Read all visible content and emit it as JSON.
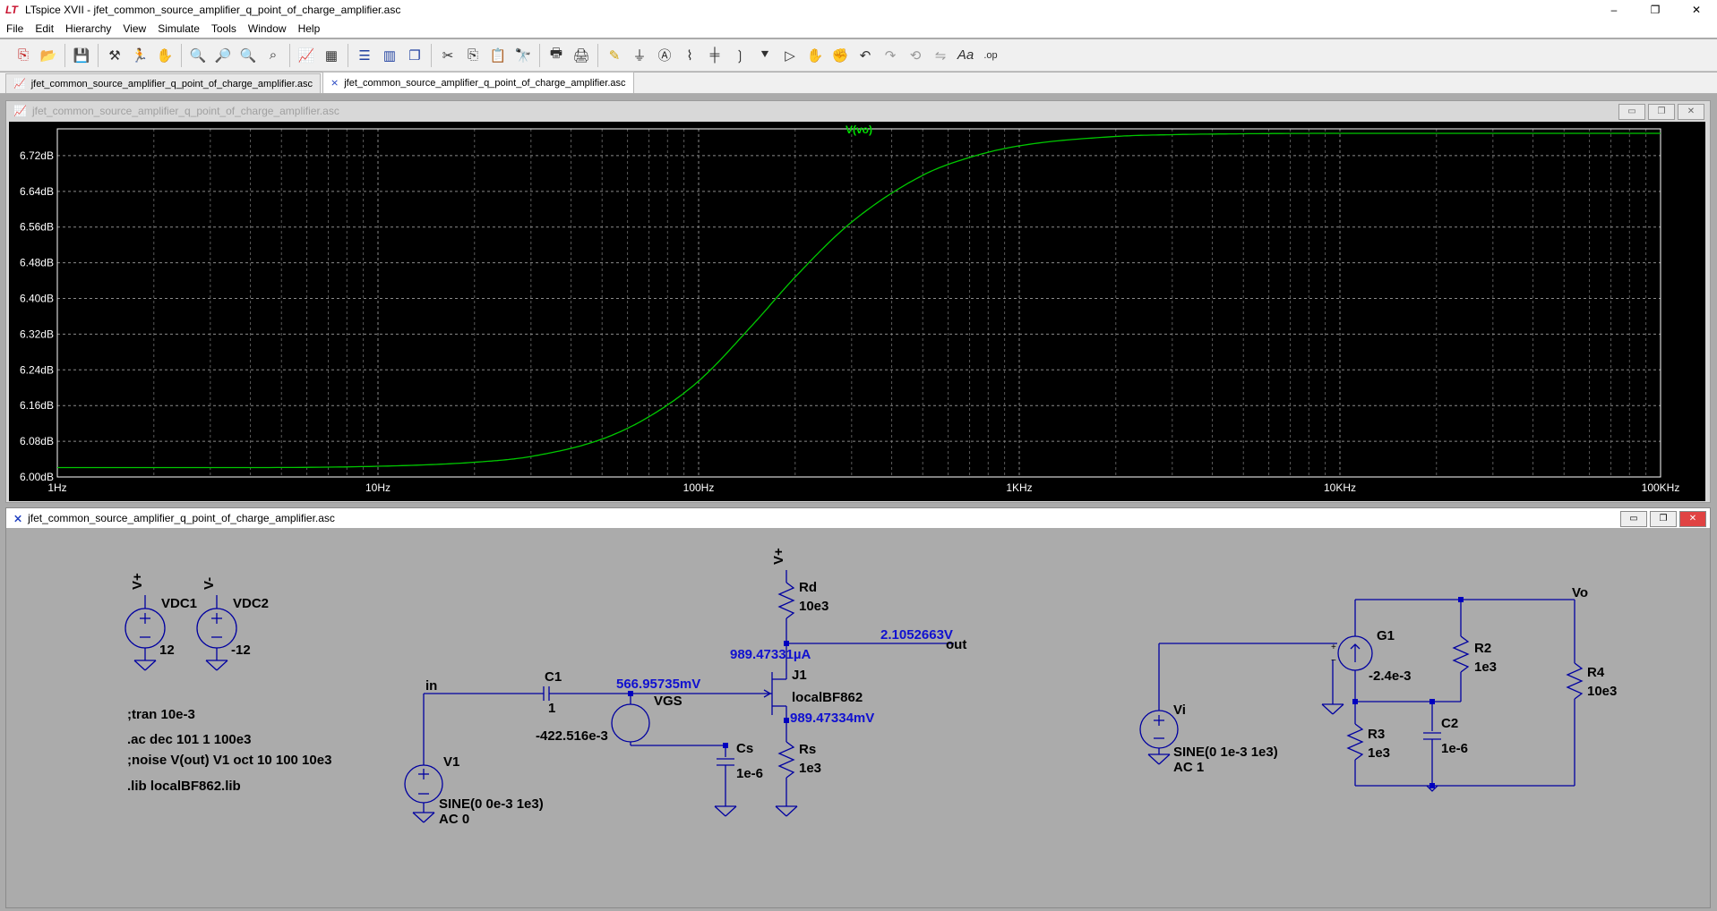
{
  "window": {
    "title": "LTspice XVII - jfet_common_source_amplifier_q_point_of_charge_amplifier.asc",
    "logo": "LT",
    "controls": [
      "–",
      "❐",
      "✕"
    ]
  },
  "menu": [
    "File",
    "Edit",
    "Hierarchy",
    "View",
    "Simulate",
    "Tools",
    "Window",
    "Help"
  ],
  "toolbar_icons": [
    "new-schematic-icon",
    "open-icon",
    "save-icon",
    "control-panel-icon",
    "run-icon",
    "halt-icon",
    "zoom-in-icon",
    "zoom-pan-icon",
    "zoom-out-icon",
    "zoom-fit-icon",
    "autorange-icon",
    "plot-settings-icon",
    "tile-horizontal-icon",
    "tile-vertical-icon",
    "cascade-icon",
    "cut-icon",
    "copy-icon",
    "paste-icon",
    "find-icon",
    "print-icon",
    "print-preview-icon",
    "draw-wire-icon",
    "ground-icon",
    "label-net-icon",
    "resistor-icon",
    "capacitor-icon",
    "inductor-icon",
    "diode-icon",
    "component-icon",
    "move-icon",
    "drag-icon",
    "undo-icon",
    "redo-icon",
    "rotate-icon",
    "mirror-icon",
    "text-icon",
    "spice-directive-icon"
  ],
  "tabs": [
    {
      "label": "jfet_common_source_amplifier_q_point_of_charge_amplifier.asc",
      "icon": "waveform-icon"
    },
    {
      "label": "jfet_common_source_amplifier_q_point_of_charge_amplifier.asc",
      "icon": "schematic-icon"
    }
  ],
  "waveform_window": {
    "title": "jfet_common_source_amplifier_q_point_of_charge_amplifier.asc",
    "controls": [
      "▭",
      "❐",
      "✕"
    ]
  },
  "schematic_window": {
    "title": "jfet_common_source_amplifier_q_point_of_charge_amplifier.asc",
    "controls": [
      "▭",
      "❐",
      "✕"
    ]
  },
  "chart_data": {
    "type": "line",
    "title": "V(vo)",
    "x_scale": "log",
    "xlim": [
      1,
      100000
    ],
    "ylim": [
      6.0,
      6.78
    ],
    "grid": true,
    "x_ticks": [
      {
        "value": 1,
        "label": "1Hz"
      },
      {
        "value": 10,
        "label": "10Hz"
      },
      {
        "value": 100,
        "label": "100Hz"
      },
      {
        "value": 1000,
        "label": "1KHz"
      },
      {
        "value": 10000,
        "label": "10KHz"
      },
      {
        "value": 100000,
        "label": "100KHz"
      }
    ],
    "y_ticks": [
      {
        "value": 6.0,
        "label": "6.00dB"
      },
      {
        "value": 6.08,
        "label": "6.08dB"
      },
      {
        "value": 6.16,
        "label": "6.16dB"
      },
      {
        "value": 6.24,
        "label": "6.24dB"
      },
      {
        "value": 6.32,
        "label": "6.32dB"
      },
      {
        "value": 6.4,
        "label": "6.40dB"
      },
      {
        "value": 6.48,
        "label": "6.48dB"
      },
      {
        "value": 6.56,
        "label": "6.56dB"
      },
      {
        "value": 6.64,
        "label": "6.64dB"
      },
      {
        "value": 6.72,
        "label": "6.72dB"
      }
    ],
    "series": [
      {
        "name": "V(vo)",
        "color": "#00c800",
        "x": [
          1,
          3,
          10,
          20,
          30,
          50,
          70,
          100,
          150,
          200,
          300,
          500,
          700,
          1000,
          2000,
          3000,
          5000,
          10000,
          100000
        ],
        "y": [
          6.021,
          6.021,
          6.024,
          6.033,
          6.046,
          6.085,
          6.135,
          6.215,
          6.347,
          6.448,
          6.571,
          6.676,
          6.716,
          6.742,
          6.763,
          6.767,
          6.769,
          6.77,
          6.77
        ]
      }
    ]
  },
  "schematic": {
    "labels": {
      "vplus": "V+",
      "vminus": "V-",
      "vdc1": "VDC1",
      "vdc2": "VDC2",
      "vdc1_val": "12",
      "vdc2_val": "-12",
      "rd": "Rd",
      "rd_val": "10e3",
      "j1": "J1",
      "j1_model": "localBF862",
      "rs": "Rs",
      "rs_val": "1e3",
      "cs": "Cs",
      "cs_val": "1e-6",
      "c1": "C1",
      "c1_val": "1",
      "vgs": "VGS",
      "vgs_val": "-422.516e-3",
      "v1": "V1",
      "v1_val1": "SINE(0 0e-3 1e3)",
      "v1_val2": "AC 0",
      "net_in": "in",
      "net_out": "out",
      "g1": "G1",
      "g1_val": "-2.4e-3",
      "r2": "R2",
      "r2_val": "1e3",
      "r3": "R3",
      "r3_val": "1e3",
      "r4": "R4",
      "r4_val": "10e3",
      "c2": "C2",
      "c2_val": "1e-6",
      "vi": "Vi",
      "vi_val1": "SINE(0 1e-3 1e3)",
      "vi_val2": "AC 1",
      "net_vo": "Vo"
    },
    "op_points": {
      "vout": "2.1052663V",
      "id": "989.47331µA",
      "vg": "566.95735mV",
      "vs": "989.47334mV"
    },
    "directives": [
      ";tran 10e-3",
      ".ac dec 101 1 100e3",
      ";noise V(out) V1 oct 10 100 10e3",
      ".lib localBF862.lib"
    ]
  }
}
